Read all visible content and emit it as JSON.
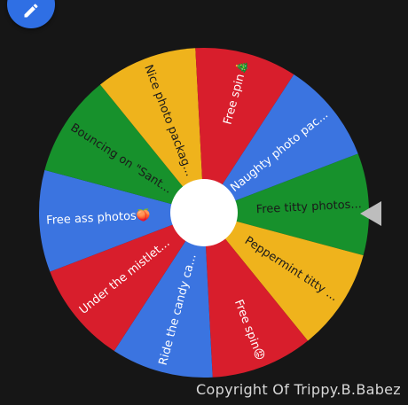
{
  "app": {
    "edit_icon": "pencil-icon",
    "watermark": "Copyright Of Trippy.B.Babez",
    "pointer_icon": "triangle-left-icon"
  },
  "wheel": {
    "segments": [
      {
        "label": "Free titty photos...",
        "color": "#17912c",
        "text_color": "#1a1a1a"
      },
      {
        "label": "Peppermint titty ...",
        "color": "#efb31c",
        "text_color": "#1a1a1a"
      },
      {
        "label": "Free spin😡",
        "color": "#d81e2c",
        "text_color": "#ffffff"
      },
      {
        "label": "Ride the candy ca...",
        "color": "#3b74e0",
        "text_color": "#ffffff"
      },
      {
        "label": "Under the mistlet...",
        "color": "#d81e2c",
        "text_color": "#ffffff"
      },
      {
        "label": "Free ass photos🍑",
        "color": "#3b74e0",
        "text_color": "#ffffff"
      },
      {
        "label": "Bouncing on \"Sant...",
        "color": "#17912c",
        "text_color": "#1a1a1a"
      },
      {
        "label": "Nice photo packag...",
        "color": "#efb31c",
        "text_color": "#1a1a1a"
      },
      {
        "label": "Free spin🎄",
        "color": "#d81e2c",
        "text_color": "#ffffff"
      },
      {
        "label": "Naughty photo pac...",
        "color": "#3b74e0",
        "text_color": "#ffffff"
      }
    ]
  }
}
